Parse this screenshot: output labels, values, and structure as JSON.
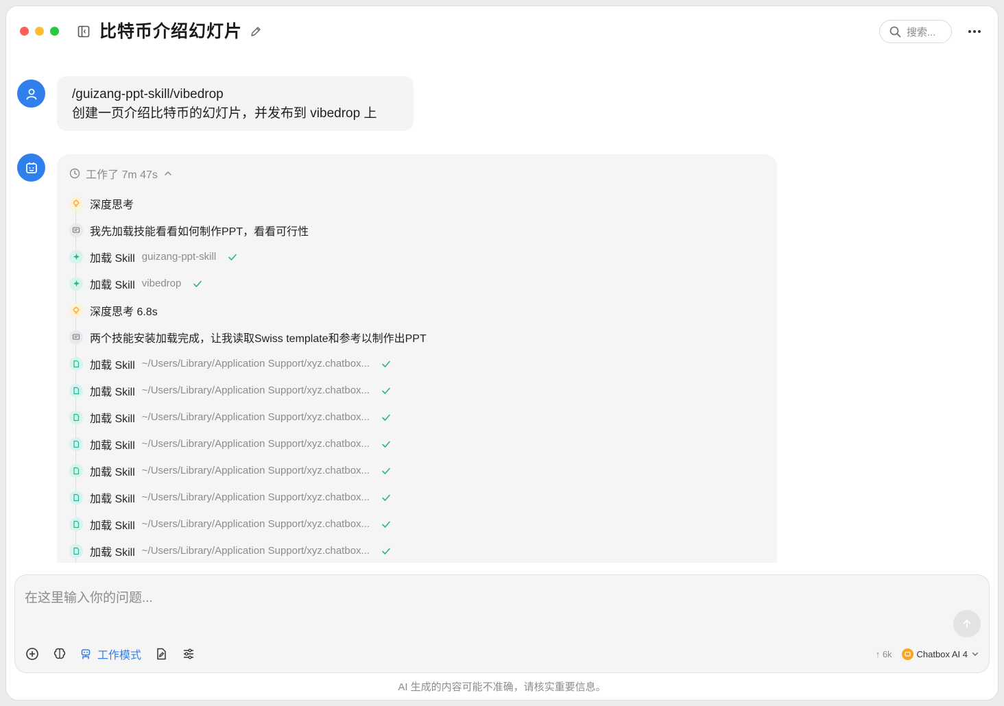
{
  "header": {
    "title": "比特币介绍幻灯片",
    "search_label": "搜索..."
  },
  "user_message": {
    "line1": "/guizang-ppt-skill/vibedrop",
    "line2": "创建一页介绍比特币的幻灯片，并发布到 vibedrop 上"
  },
  "assistant": {
    "work_time": "工作了 7m 47s",
    "steps": [
      {
        "type": "think",
        "label": "深度思考",
        "detail": ""
      },
      {
        "type": "msg",
        "label": "我先加载技能看看如何制作PPT，看看可行性",
        "detail": ""
      },
      {
        "type": "skill",
        "label": "加载 Skill",
        "detail": "guizang-ppt-skill"
      },
      {
        "type": "skill",
        "label": "加载 Skill",
        "detail": "vibedrop"
      },
      {
        "type": "think",
        "label": "深度思考 6.8s",
        "detail": ""
      },
      {
        "type": "msg",
        "label": "两个技能安装加载完成，让我读取Swiss template和参考以制作出PPT",
        "detail": ""
      },
      {
        "type": "file",
        "label": "加载 Skill",
        "detail": "~/Users/Library/Application Support/xyz.chatbox..."
      },
      {
        "type": "file",
        "label": "加载 Skill",
        "detail": "~/Users/Library/Application Support/xyz.chatbox..."
      },
      {
        "type": "file",
        "label": "加载 Skill",
        "detail": "~/Users/Library/Application Support/xyz.chatbox..."
      },
      {
        "type": "file",
        "label": "加载 Skill",
        "detail": "~/Users/Library/Application Support/xyz.chatbox..."
      },
      {
        "type": "file",
        "label": "加载 Skill",
        "detail": "~/Users/Library/Application Support/xyz.chatbox..."
      },
      {
        "type": "file",
        "label": "加载 Skill",
        "detail": "~/Users/Library/Application Support/xyz.chatbox..."
      },
      {
        "type": "file",
        "label": "加载 Skill",
        "detail": "~/Users/Library/Application Support/xyz.chatbox..."
      },
      {
        "type": "file",
        "label": "加载 Skill",
        "detail": "~/Users/Library/Application Support/xyz.chatbox..."
      }
    ]
  },
  "input": {
    "placeholder": "在这里输入你的问题...",
    "work_mode_label": "工作模式",
    "token_count": "↑ 6k",
    "model_name": "Chatbox AI 4"
  },
  "footer": {
    "disclaimer": "AI 生成的内容可能不准确，请核实重要信息。"
  },
  "colors": {
    "accent": "#2f80ed",
    "check": "#2bb673",
    "think_icon": "#f5a623",
    "skill_icon": "#1fb59a"
  }
}
